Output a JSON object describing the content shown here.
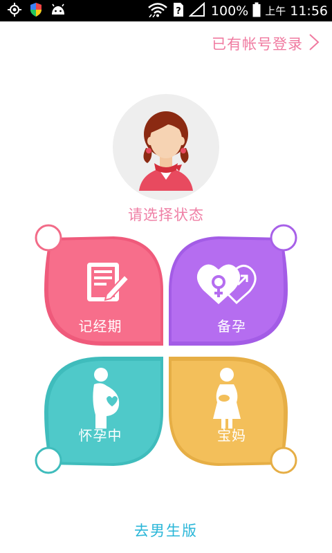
{
  "status_bar": {
    "battery": "100%",
    "ampm": "上午",
    "time": "11:56",
    "icons": [
      "gps-icon",
      "shield-icon",
      "android-icon",
      "wifi-icon",
      "no-sim-icon",
      "signal-icon",
      "battery-icon"
    ]
  },
  "header": {
    "login_label": "已有帐号登录"
  },
  "main": {
    "prompt": "请选择状态",
    "options": [
      {
        "label": "记经期",
        "icon": "notepad-pen-icon",
        "color": "#f76e8b"
      },
      {
        "label": "备孕",
        "icon": "heart-gender-icon",
        "color": "#b56df0"
      },
      {
        "label": "怀孕中",
        "icon": "pregnant-icon",
        "color": "#4fc9c9"
      },
      {
        "label": "宝妈",
        "icon": "mother-baby-icon",
        "color": "#f3bf5a"
      }
    ]
  },
  "footer": {
    "switch_label": "去男生版"
  }
}
